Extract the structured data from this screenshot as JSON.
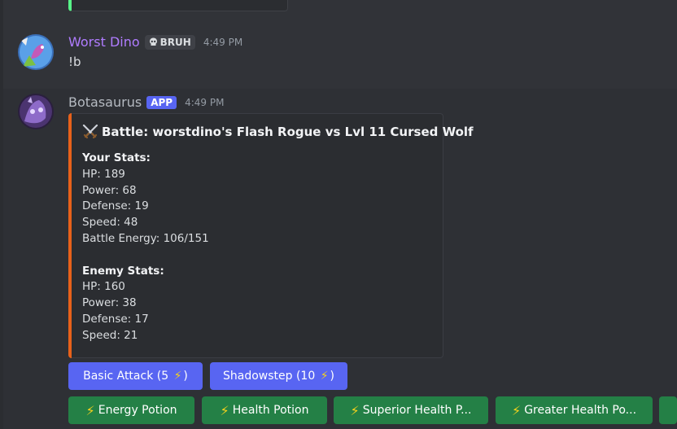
{
  "messages": [
    {
      "username": "Worst Dino",
      "tag": "BRUH",
      "timestamp": "4:49 PM",
      "content": "!b"
    },
    {
      "username": "Botasaurus",
      "tag": "APP",
      "timestamp": "4:49 PM",
      "embed": {
        "title": "Battle: worstdino's Flash Rogue vs Lvl 11 Cursed Wolf",
        "title_icon": "crossed-swords-icon",
        "accent_color": "#e8611a",
        "your_stats_heading": "Your Stats:",
        "your_stats": [
          "HP: 189",
          "Power: 68",
          "Defense: 19",
          "Speed: 48",
          "Battle Energy: 106/151"
        ],
        "enemy_stats_heading": "Enemy Stats:",
        "enemy_stats": [
          "HP: 160",
          "Power: 38",
          "Defense: 17",
          "Speed: 21"
        ]
      },
      "action_buttons": [
        {
          "label_pre": "Basic Attack (5 ",
          "label_post": ")"
        },
        {
          "label_pre": "Shadowstep (10 ",
          "label_post": ")"
        }
      ],
      "item_buttons": [
        {
          "label": "Energy Potion"
        },
        {
          "label": "Health Potion"
        },
        {
          "label": "Superior Health P..."
        },
        {
          "label": "Greater Health Po..."
        }
      ]
    }
  ],
  "colors": {
    "background": "#313338",
    "primary_button": "#5865f2",
    "success_button": "#248046",
    "dino_name": "#b07cff"
  }
}
